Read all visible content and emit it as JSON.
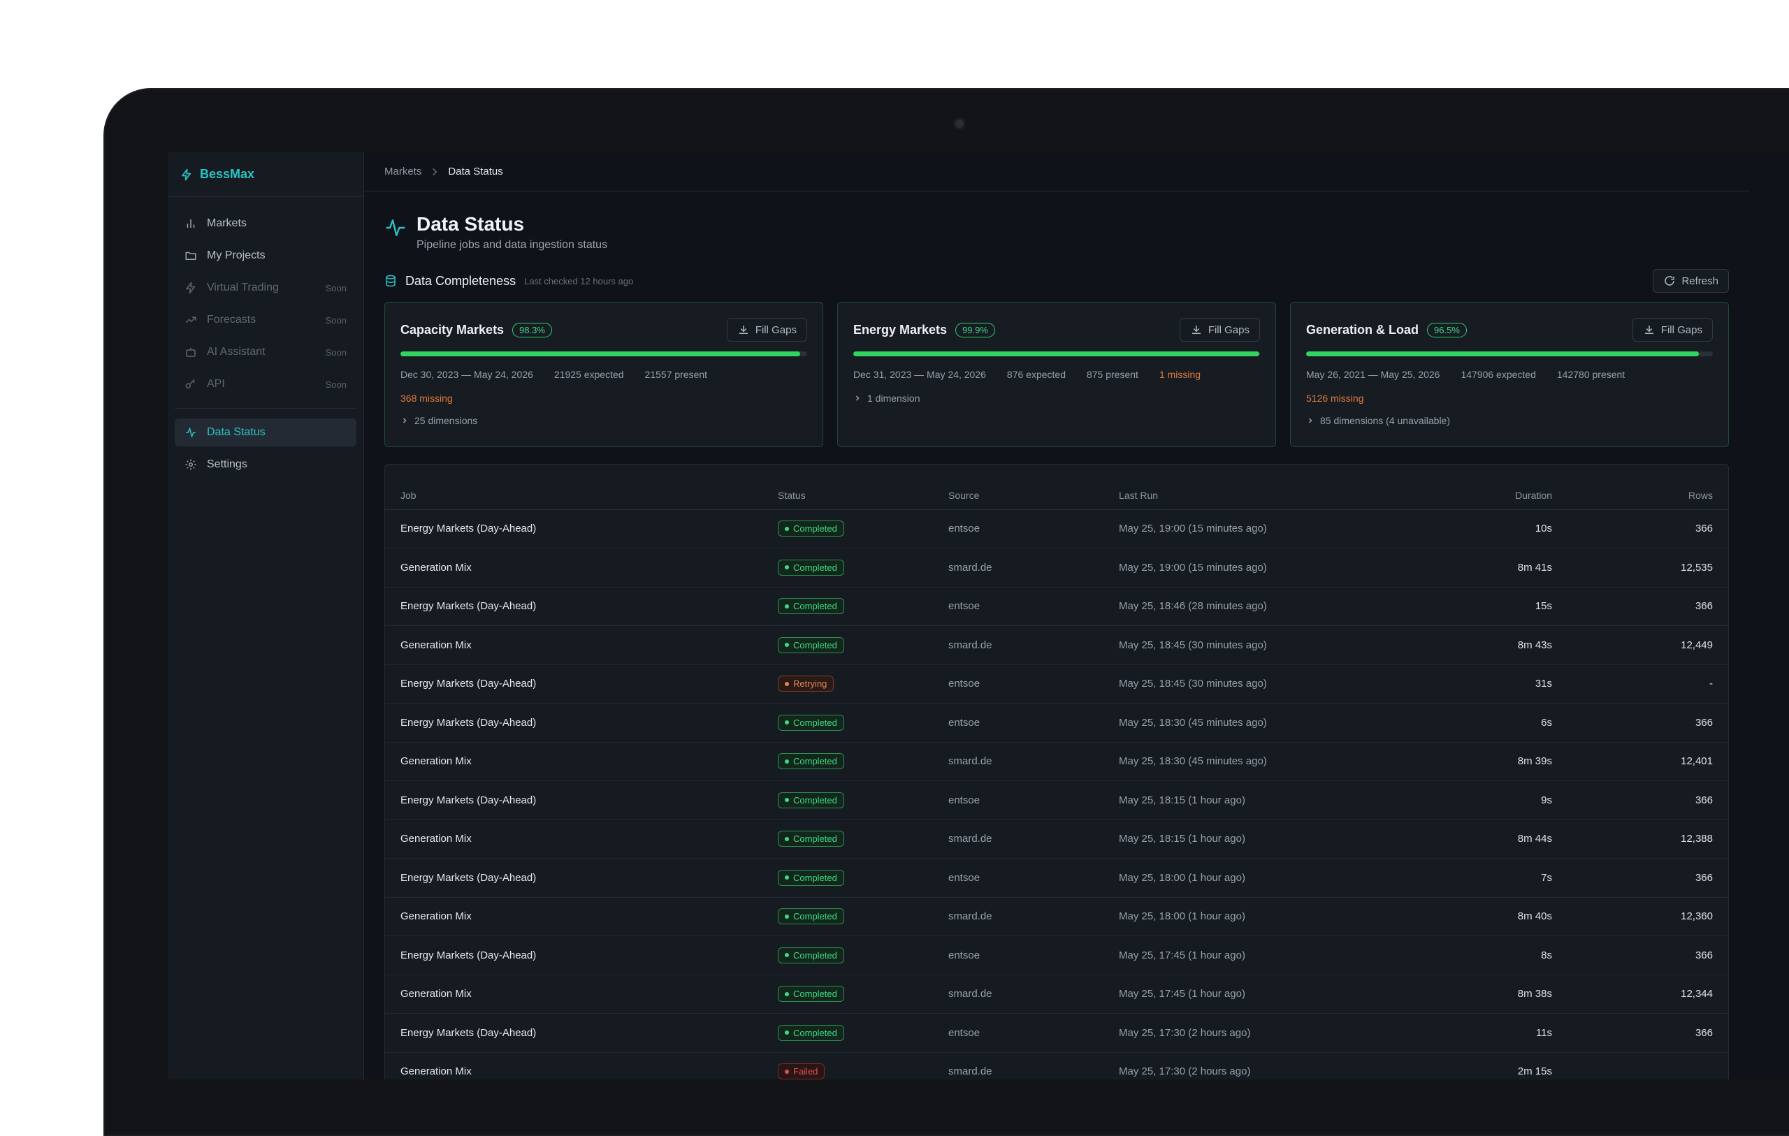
{
  "app": {
    "brand": "BessMax"
  },
  "sidebar": {
    "items": [
      {
        "label": "Markets",
        "icon": "bar-chart-icon",
        "soon": ""
      },
      {
        "label": "My Projects",
        "icon": "folder-icon",
        "soon": ""
      },
      {
        "label": "Virtual Trading",
        "icon": "lightning-icon",
        "soon": "Soon"
      },
      {
        "label": "Forecasts",
        "icon": "trending-up-icon",
        "soon": "Soon"
      },
      {
        "label": "AI Assistant",
        "icon": "bot-icon",
        "soon": "Soon"
      },
      {
        "label": "API",
        "icon": "key-icon",
        "soon": "Soon"
      }
    ],
    "bottom_items": [
      {
        "label": "Data Status",
        "icon": "activity-icon"
      },
      {
        "label": "Settings",
        "icon": "gear-icon"
      }
    ]
  },
  "breadcrumb": {
    "parent": "Markets",
    "current": "Data Status"
  },
  "page": {
    "title": "Data Status",
    "subtitle": "Pipeline jobs and data ingestion status"
  },
  "completeness": {
    "title": "Data Completeness",
    "last_checked": "Last checked 12 hours ago",
    "refresh_label": "Refresh",
    "cards": [
      {
        "title": "Capacity Markets",
        "pct": "98.3%",
        "progress": 0.983,
        "fill_label": "Fill Gaps",
        "range": "Dec 30, 2023 — May 24, 2026",
        "expected": "21925 expected",
        "present": "21557 present",
        "missing": "368 missing",
        "dims": "25 dimensions"
      },
      {
        "title": "Energy Markets",
        "pct": "99.9%",
        "progress": 0.999,
        "fill_label": "Fill Gaps",
        "range": "Dec 31, 2023 — May 24, 2026",
        "expected": "876 expected",
        "present": "875 present",
        "missing": "1 missing",
        "dims": "1 dimension"
      },
      {
        "title": "Generation & Load",
        "pct": "96.5%",
        "progress": 0.965,
        "fill_label": "Fill Gaps",
        "range": "May 26, 2021 — May 25, 2026",
        "expected": "147906 expected",
        "present": "142780 present",
        "missing": "5126 missing",
        "dims": "85 dimensions (4 unavailable)"
      }
    ]
  },
  "table": {
    "headers": {
      "job": "Job",
      "status": "Status",
      "source": "Source",
      "last_run": "Last Run",
      "duration": "Duration",
      "rows": "Rows"
    },
    "rows": [
      {
        "job": "Energy Markets (Day-Ahead)",
        "status": "Completed",
        "source": "entsoe",
        "last_run": "May 25, 19:00 (15 minutes ago)",
        "duration": "10s",
        "rows": "366"
      },
      {
        "job": "Generation Mix",
        "status": "Completed",
        "source": "smard.de",
        "last_run": "May 25, 19:00 (15 minutes ago)",
        "duration": "8m 41s",
        "rows": "12,535"
      },
      {
        "job": "Energy Markets (Day-Ahead)",
        "status": "Completed",
        "source": "entsoe",
        "last_run": "May 25, 18:46 (28 minutes ago)",
        "duration": "15s",
        "rows": "366"
      },
      {
        "job": "Generation Mix",
        "status": "Completed",
        "source": "smard.de",
        "last_run": "May 25, 18:45 (30 minutes ago)",
        "duration": "8m 43s",
        "rows": "12,449"
      },
      {
        "job": "Energy Markets (Day-Ahead)",
        "status": "Retrying",
        "source": "entsoe",
        "last_run": "May 25, 18:45 (30 minutes ago)",
        "duration": "31s",
        "rows": "-"
      },
      {
        "job": "Energy Markets (Day-Ahead)",
        "status": "Completed",
        "source": "entsoe",
        "last_run": "May 25, 18:30 (45 minutes ago)",
        "duration": "6s",
        "rows": "366"
      },
      {
        "job": "Generation Mix",
        "status": "Completed",
        "source": "smard.de",
        "last_run": "May 25, 18:30 (45 minutes ago)",
        "duration": "8m 39s",
        "rows": "12,401"
      },
      {
        "job": "Energy Markets (Day-Ahead)",
        "status": "Completed",
        "source": "entsoe",
        "last_run": "May 25, 18:15 (1 hour ago)",
        "duration": "9s",
        "rows": "366"
      },
      {
        "job": "Generation Mix",
        "status": "Completed",
        "source": "smard.de",
        "last_run": "May 25, 18:15 (1 hour ago)",
        "duration": "8m 44s",
        "rows": "12,388"
      },
      {
        "job": "Energy Markets (Day-Ahead)",
        "status": "Completed",
        "source": "entsoe",
        "last_run": "May 25, 18:00 (1 hour ago)",
        "duration": "7s",
        "rows": "366"
      },
      {
        "job": "Generation Mix",
        "status": "Completed",
        "source": "smard.de",
        "last_run": "May 25, 18:00 (1 hour ago)",
        "duration": "8m 40s",
        "rows": "12,360"
      },
      {
        "job": "Energy Markets (Day-Ahead)",
        "status": "Completed",
        "source": "entsoe",
        "last_run": "May 25, 17:45 (1 hour ago)",
        "duration": "8s",
        "rows": "366"
      },
      {
        "job": "Generation Mix",
        "status": "Completed",
        "source": "smard.de",
        "last_run": "May 25, 17:45 (1 hour ago)",
        "duration": "8m 38s",
        "rows": "12,344"
      },
      {
        "job": "Energy Markets (Day-Ahead)",
        "status": "Completed",
        "source": "entsoe",
        "last_run": "May 25, 17:30 (2 hours ago)",
        "duration": "11s",
        "rows": "366"
      },
      {
        "job": "Generation Mix",
        "status": "Failed",
        "source": "smard.de",
        "last_run": "May 25, 17:30 (2 hours ago)",
        "duration": "2m 15s",
        "rows": ""
      }
    ]
  },
  "colors": {
    "accent": "#2bc4c4",
    "success": "#3ddc84",
    "warning": "#e28457",
    "error": "#e05252"
  }
}
